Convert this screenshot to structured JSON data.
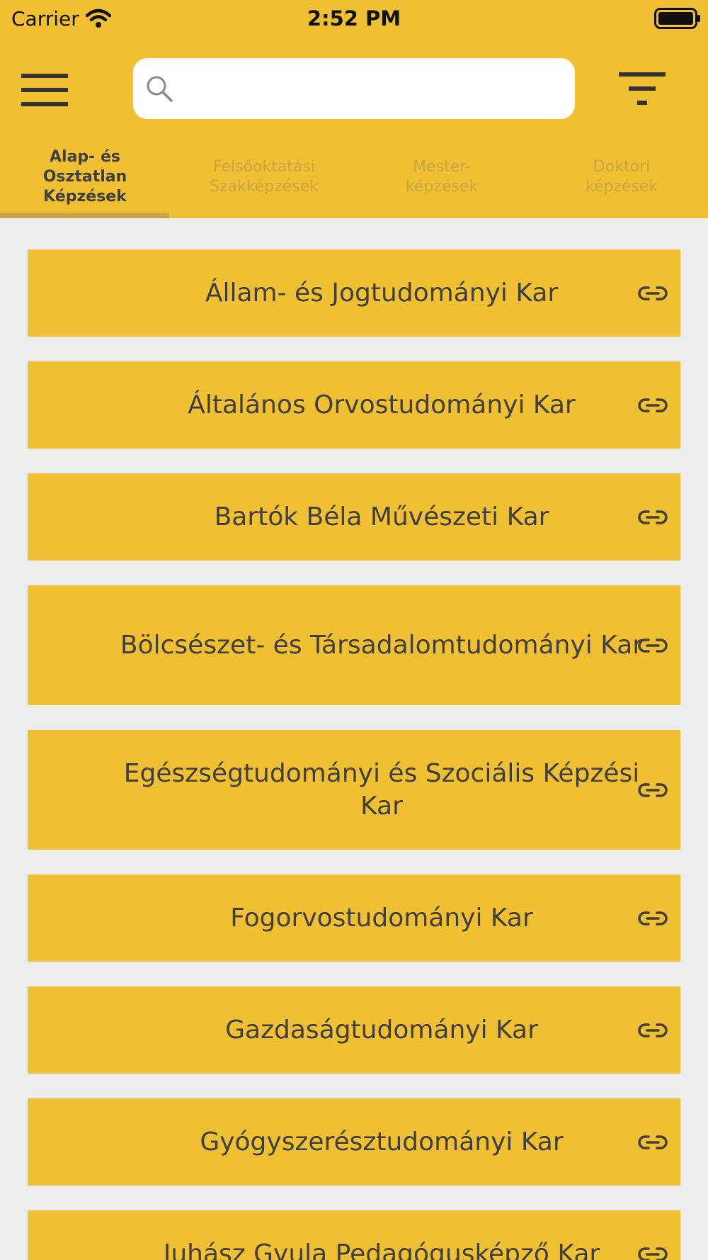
{
  "status_bar": {
    "carrier": "Carrier",
    "time": "2:52 PM"
  },
  "toolbar": {
    "menu_icon": "hamburger-menu-icon",
    "search_placeholder": "",
    "search_value": "",
    "filter_icon": "filter-icon"
  },
  "tabs": [
    {
      "label": "Alap- és Osztatlan Képzések",
      "active": true
    },
    {
      "label": "Felsőoktatási Szakképzések",
      "active": false
    },
    {
      "label": "Mester-képzések",
      "active": false
    },
    {
      "label": "Doktori képzések",
      "active": false
    }
  ],
  "faculties": [
    {
      "label": "Állam- és Jogtudományi Kar",
      "icon": "link-icon"
    },
    {
      "label": "Általános Orvostudományi Kar",
      "icon": "link-icon"
    },
    {
      "label": "Bartók Béla Művészeti Kar",
      "icon": "link-icon"
    },
    {
      "label": "Bölcsészet- és Társadalomtudományi Kar",
      "icon": "link-icon"
    },
    {
      "label": "Egészségtudományi és Szociális Képzési Kar",
      "icon": "link-icon"
    },
    {
      "label": "Fogorvostudományi Kar",
      "icon": "link-icon"
    },
    {
      "label": "Gazdaságtudományi Kar",
      "icon": "link-icon"
    },
    {
      "label": "Gyógyszerésztudományi Kar",
      "icon": "link-icon"
    },
    {
      "label": "Juhász Gyula Pedagógusképző Kar",
      "icon": "link-icon"
    }
  ],
  "colors": {
    "accent": "#f0c032",
    "background": "#ededed",
    "text": "#3f3f3f",
    "inactive_tab_text": "#c8a542"
  }
}
